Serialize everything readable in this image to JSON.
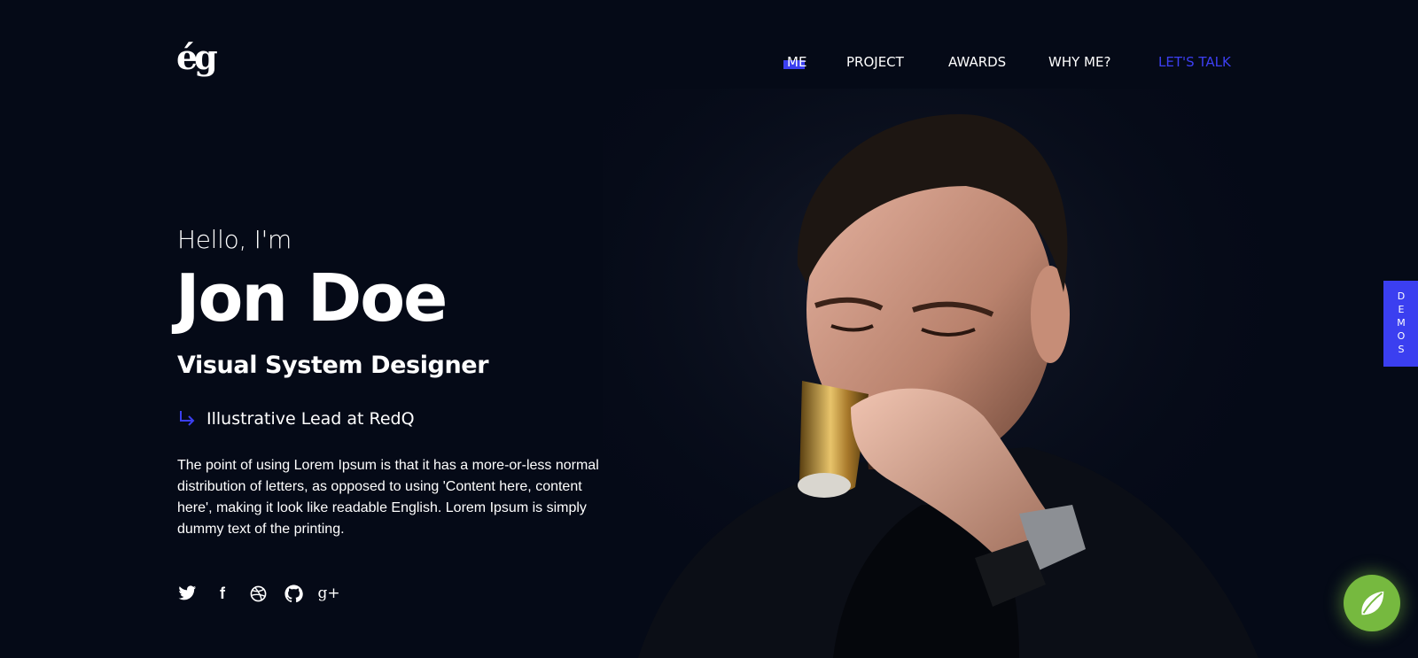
{
  "header": {
    "logo_text": "ég",
    "nav": {
      "me": "ME",
      "project": "PROJECT",
      "awards": "AWARDS",
      "why_me": "WHY ME?",
      "cta": "LET'S TALK"
    }
  },
  "hero": {
    "greeting": "Hello, I'm",
    "name": "Jon Doe",
    "role": "Visual System Designer",
    "position": "Illustrative Lead at RedQ",
    "bio": "The point of using Lorem Ipsum is that it has a more-or-less normal distribution of letters, as opposed to using 'Content here, content here', making it look like readable English. Lorem Ipsum is simply dummy text of the printing."
  },
  "socials": [
    {
      "icon": "twitter-icon"
    },
    {
      "icon": "facebook-icon",
      "label": "f"
    },
    {
      "icon": "dribbble-icon"
    },
    {
      "icon": "github-icon"
    },
    {
      "icon": "google-plus-icon",
      "label": "g+"
    }
  ],
  "side_tab": {
    "label": "DEMOS"
  },
  "colors": {
    "background": "#050a17",
    "accent": "#3b3ff0",
    "chat": "#76b93f",
    "text": "#ffffff"
  }
}
